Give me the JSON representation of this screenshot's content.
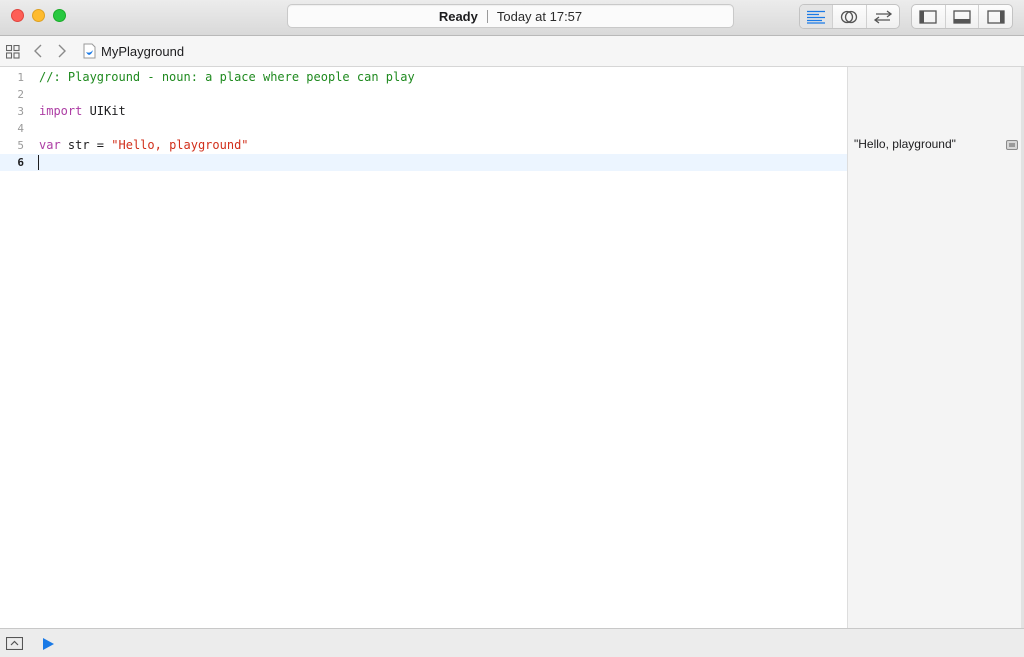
{
  "window": {
    "status_state": "Ready",
    "status_time": "Today at 17:57"
  },
  "jumpbar": {
    "file_name": "MyPlayground"
  },
  "editor": {
    "lines": [
      {
        "number": "1",
        "tokens": [
          {
            "text": "//: Playground - noun: a place where people can play",
            "kind": "comment"
          }
        ]
      },
      {
        "number": "2",
        "tokens": []
      },
      {
        "number": "3",
        "tokens": [
          {
            "text": "import",
            "kind": "keyword"
          },
          {
            "text": " UIKit",
            "kind": "plain"
          }
        ]
      },
      {
        "number": "4",
        "tokens": []
      },
      {
        "number": "5",
        "tokens": [
          {
            "text": "var",
            "kind": "keyword"
          },
          {
            "text": " str = ",
            "kind": "plain"
          },
          {
            "text": "\"Hello, playground\"",
            "kind": "string"
          }
        ]
      },
      {
        "number": "6",
        "tokens": [],
        "current": true
      }
    ]
  },
  "results": {
    "line5_value": "\"Hello, playground\""
  },
  "colors": {
    "comment": "#1f8a1f",
    "keyword": "#ad3da4",
    "string": "#d12f1b",
    "accent": "#1a7ae6",
    "current_line": "#ecf5ff"
  },
  "icons": {
    "toolbar_editors": [
      "standard-editor-icon",
      "assistant-editor-icon",
      "version-editor-icon"
    ],
    "toolbar_views": [
      "navigator-toggle-icon",
      "debug-area-toggle-icon",
      "utilities-toggle-icon"
    ],
    "jumpbar": [
      "related-items-grid-icon",
      "back-chevron-icon",
      "forward-chevron-icon",
      "swift-file-icon"
    ],
    "debug": [
      "debug-area-toggle-icon",
      "run-play-icon"
    ]
  }
}
